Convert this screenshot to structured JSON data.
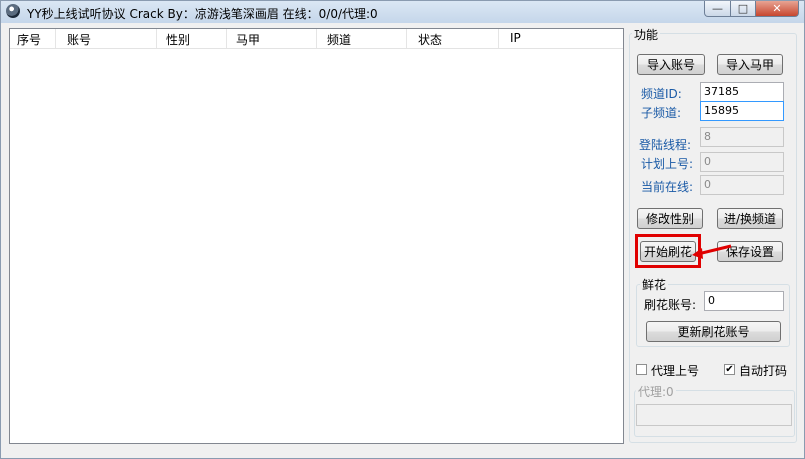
{
  "window": {
    "title": "YY秒上线试听协议 Crack By：凉游浅笔深画眉  在线：0/0/代理:0",
    "min_glyph": "—",
    "max_glyph": "□",
    "close_glyph": "✕"
  },
  "list": {
    "columns": [
      "序号",
      "账号",
      "性别",
      "马甲",
      "频道",
      "状态",
      "IP"
    ],
    "rows": []
  },
  "function_group": {
    "title": "功能",
    "import_account_btn": "导入账号",
    "import_vest_btn": "导入马甲",
    "channel_id_label": "频道ID:",
    "channel_id_value": "37185",
    "sub_channel_label": "子频道:",
    "sub_channel_value": "15895",
    "login_threads_label": "登陆线程:",
    "login_threads_value": "8",
    "plan_accounts_label": "计划上号:",
    "plan_accounts_value": "0",
    "online_now_label": "当前在线:",
    "online_now_value": "0",
    "change_gender_btn": "修改性别",
    "switch_channel_btn": "进/换频道",
    "start_flowers_btn": "开始刷花",
    "save_settings_btn": "保存设置"
  },
  "flower_group": {
    "title": "鲜花",
    "account_label": "刷花账号:",
    "account_value": "0",
    "update_btn": "更新刷花账号"
  },
  "options": {
    "proxy_login_label": "代理上号",
    "proxy_login_checked": false,
    "auto_captcha_label": "自动打码",
    "auto_captcha_checked": true,
    "check_glyph": "✔"
  },
  "proxy_group": {
    "title": "代理:0"
  },
  "annotation": {
    "color": "#e00000"
  }
}
